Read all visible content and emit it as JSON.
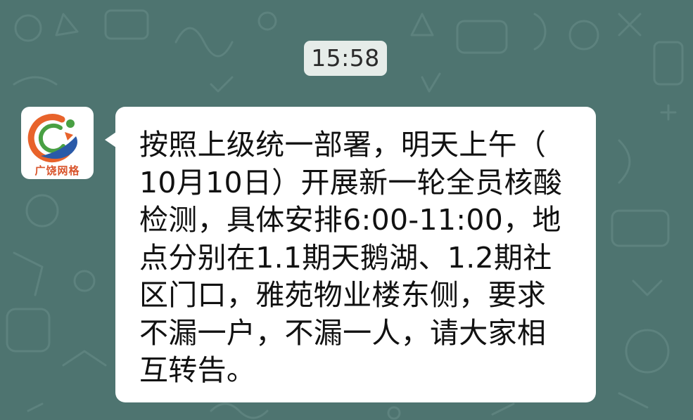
{
  "chat": {
    "timestamp": "15:58",
    "sender": {
      "avatar_label": "广饶网格",
      "avatar_icon": "guangrao-grid-logo-icon"
    },
    "message": {
      "lines": [
        "按照上级统一部署，明天上午（",
        "10月10日）开展新一轮全员核酸",
        "检测，具体安排6:00-11:00，地",
        "点分别在1.1期天鹅湖、1.2期社",
        "区门口，雅苑物业楼东侧，要求",
        "不漏一户，不漏一人，请大家相",
        "互转告。"
      ]
    }
  },
  "colors": {
    "background": "#4e7470",
    "bubble": "#ffffff",
    "timestamp_bg": "#e6ece9",
    "logo_orange": "#e8632b",
    "logo_green": "#49a043",
    "logo_blue": "#2a5aa8"
  }
}
